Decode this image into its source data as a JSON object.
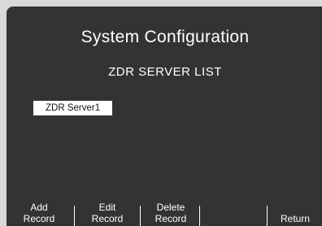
{
  "screen": {
    "title": "System Configuration",
    "subtitle": "ZDR SERVER LIST"
  },
  "server_list": {
    "items": [
      {
        "label": "ZDR Server1",
        "selected": true
      }
    ]
  },
  "softkeys": [
    {
      "label": "Add\nRecord"
    },
    {
      "label": "Edit\nRecord"
    },
    {
      "label": "Delete\nRecord"
    },
    {
      "label": ""
    },
    {
      "label": "Return"
    }
  ]
}
